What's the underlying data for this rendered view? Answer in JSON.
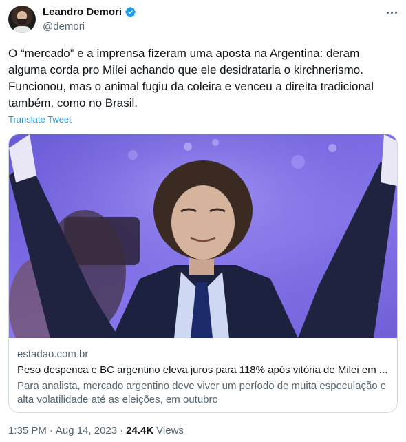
{
  "author": {
    "display_name": "Leandro Demori",
    "handle": "@demori",
    "verified": true
  },
  "icons": {
    "verified": "verified-badge-icon",
    "more": "more-options-icon"
  },
  "colors": {
    "link": "#1d9bf0",
    "verified": "#1d9bf0",
    "secondary_text": "#536471",
    "border": "#cfd9de"
  },
  "tweet": {
    "text": "O “mercado” e a imprensa fizeram uma aposta na Argentina: deram alguma corda pro Milei achando que ele desidrataria o kirchnerismo. Funcionou, mas o animal fugiu da coleira e venceu a direita tradicional também, como no Brasil.",
    "translate_label": "Translate Tweet"
  },
  "link_card": {
    "domain": "estadao.com.br",
    "title": "Peso despenca e BC argentino eleva juros para 118% após vitória de Milei em ...",
    "description": "Para analista, mercado argentino deve viver um período de muita especulação e alta volatilidade até as eleições, em outubro"
  },
  "meta": {
    "time": "1:35 PM",
    "date": "Aug 14, 2023",
    "separator": "·",
    "views_count": "24.4K",
    "views_label": "Views"
  }
}
